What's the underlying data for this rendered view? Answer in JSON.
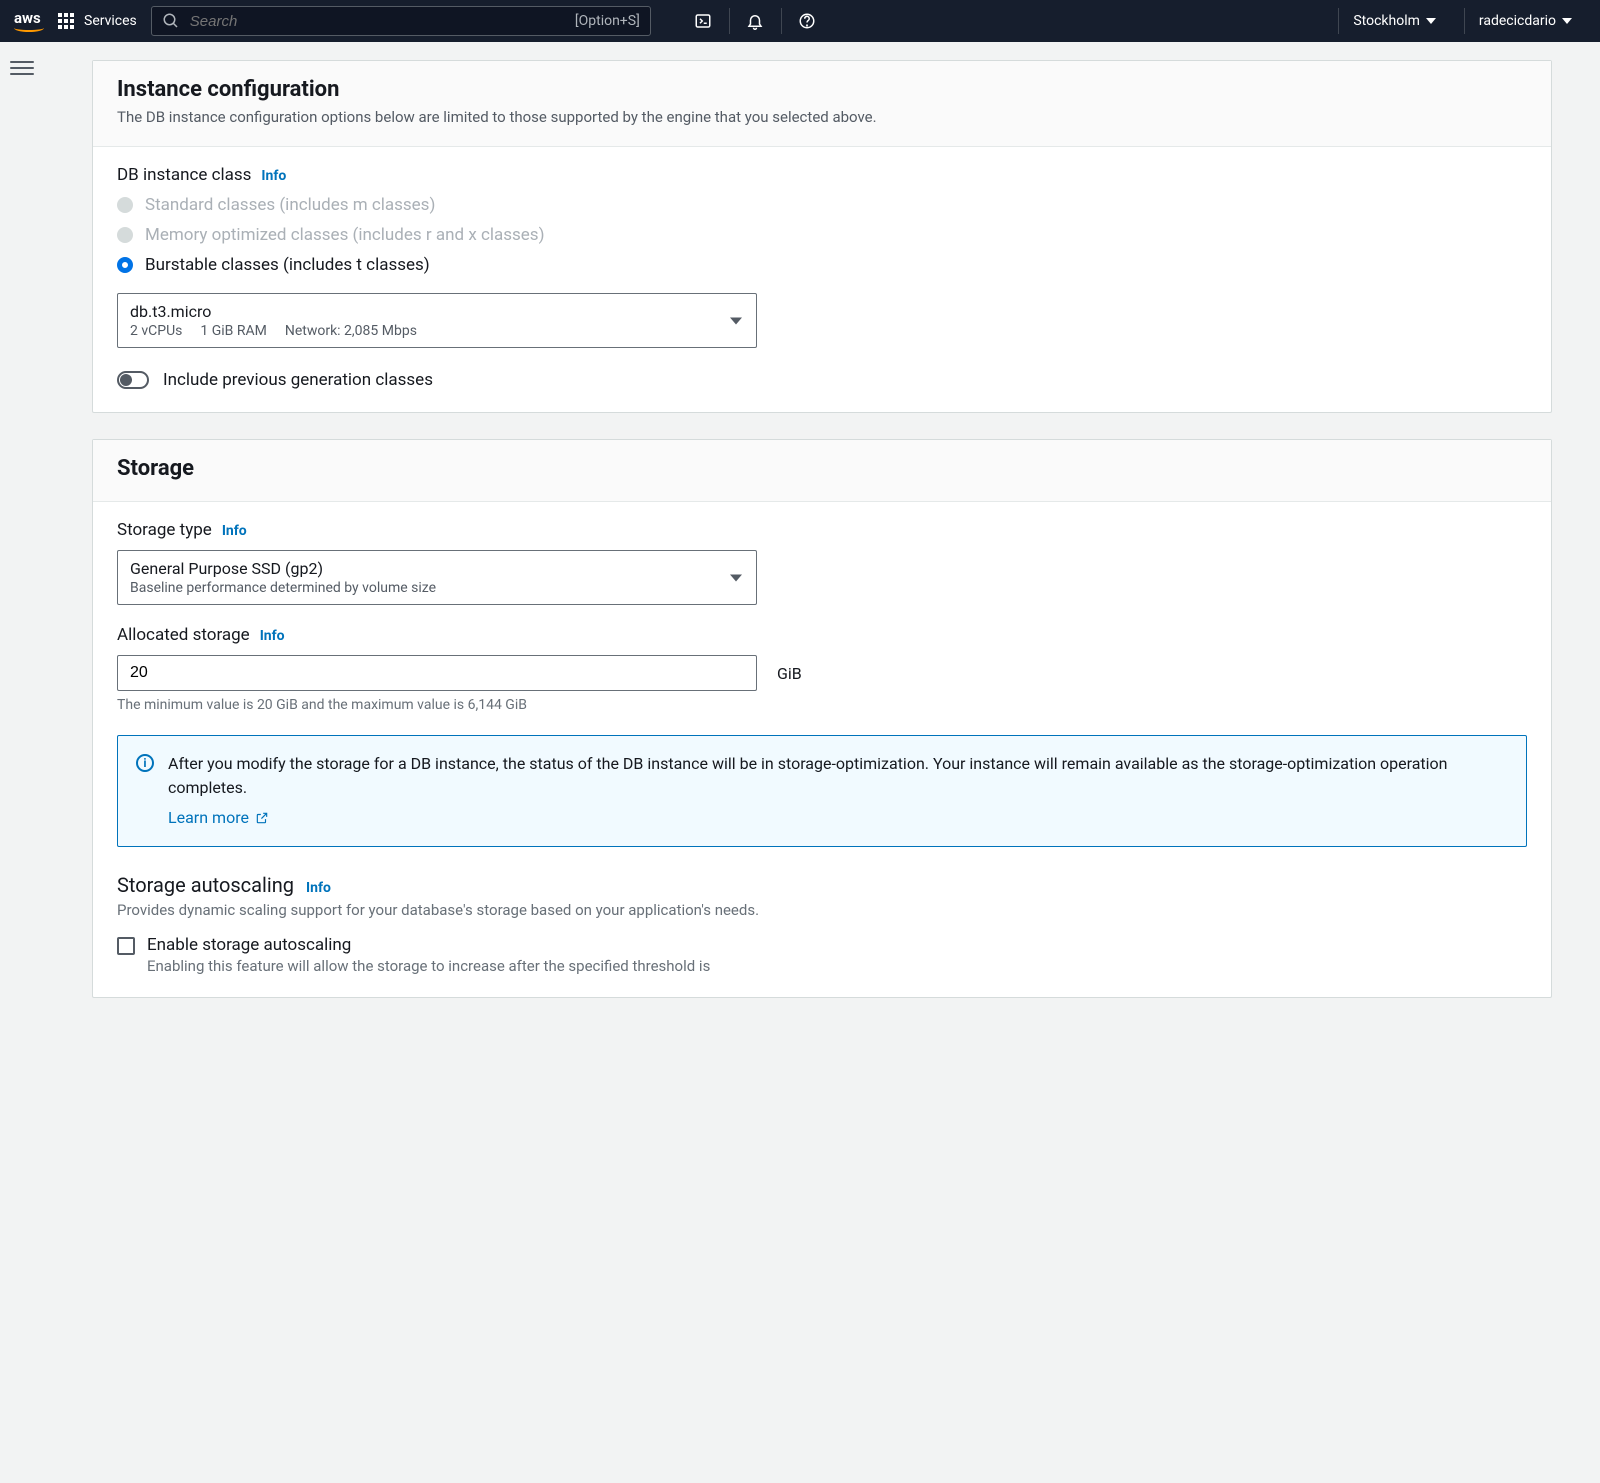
{
  "nav": {
    "logo": "aws",
    "services": "Services",
    "search_placeholder": "Search",
    "kbd": "[Option+S]",
    "region": "Stockholm",
    "user": "radecicdario"
  },
  "instance_config": {
    "title": "Instance configuration",
    "desc": "The DB instance configuration options below are limited to those supported by the engine that you selected above.",
    "class_label": "DB instance class",
    "info": "Info",
    "radios": {
      "standard": "Standard classes (includes m classes)",
      "memory": "Memory optimized classes (includes r and x classes)",
      "burstable": "Burstable classes (includes t classes)"
    },
    "selected_instance": {
      "name": "db.t3.micro",
      "vcpus": "2 vCPUs",
      "ram": "1 GiB RAM",
      "network": "Network: 2,085 Mbps"
    },
    "toggle_label": "Include previous generation classes"
  },
  "storage": {
    "title": "Storage",
    "type_label": "Storage type",
    "info": "Info",
    "type_selected": {
      "name": "General Purpose SSD (gp2)",
      "desc": "Baseline performance determined by volume size"
    },
    "allocated_label": "Allocated storage",
    "allocated_value": "20",
    "unit": "GiB",
    "allocated_hint": "The minimum value is 20 GiB and the maximum value is 6,144 GiB",
    "info_box": "After you modify the storage for a DB instance, the status of the DB instance will be in storage-optimization. Your instance will remain available as the storage-optimization operation completes.",
    "learn_more": "Learn more",
    "autoscaling": {
      "title": "Storage autoscaling",
      "desc": "Provides dynamic scaling support for your database's storage based on your application's needs.",
      "checkbox_label": "Enable storage autoscaling",
      "checkbox_desc": "Enabling this feature will allow the storage to increase after the specified threshold is"
    }
  }
}
